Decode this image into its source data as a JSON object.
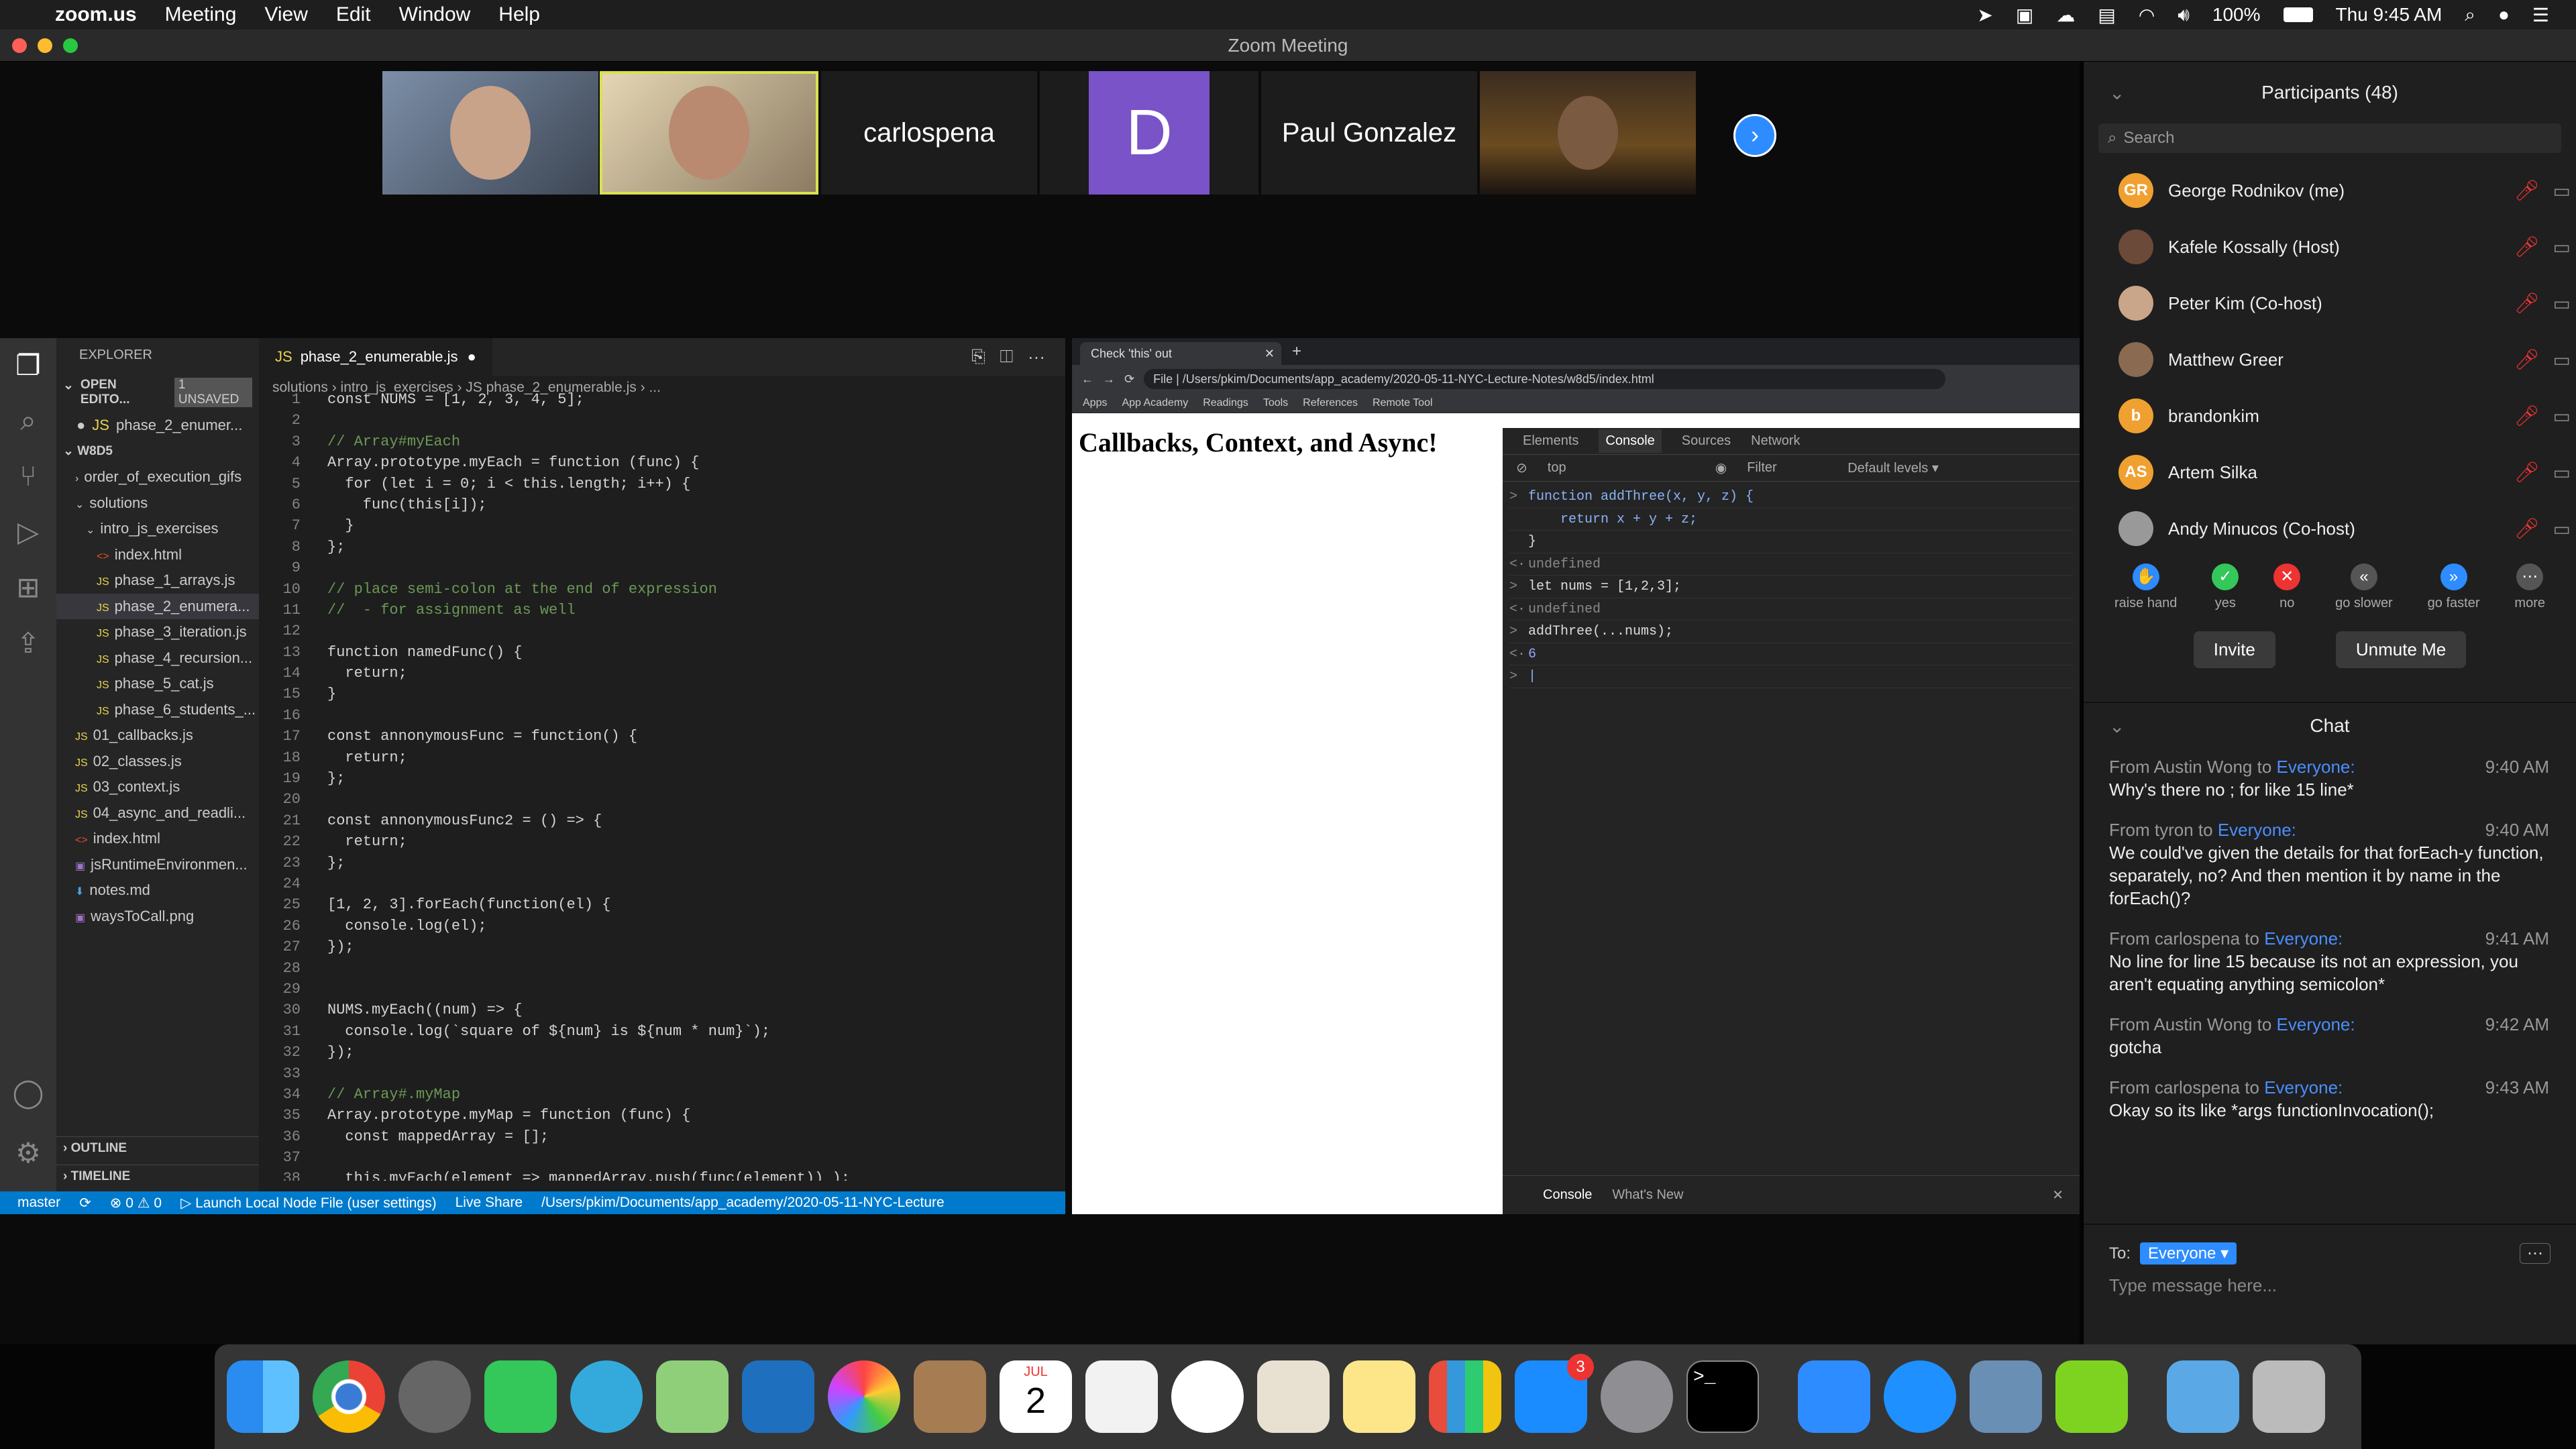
{
  "menubar": {
    "app": "zoom.us",
    "items": [
      "Meeting",
      "View",
      "Edit",
      "Window",
      "Help"
    ],
    "battery": "100%",
    "clock": "Thu 9:45 AM"
  },
  "window": {
    "title": "Zoom Meeting"
  },
  "gallery": {
    "names": [
      "carlospena",
      "D",
      "Paul Gonzalez"
    ]
  },
  "participants": {
    "title": "Participants (48)",
    "search_placeholder": "Search",
    "list": [
      {
        "initials": "GR",
        "name": "George Rodnikov (me)",
        "color": "#f0a030"
      },
      {
        "initials": "",
        "name": "Kafele Kossally (Host)",
        "color": "#6b4a3a"
      },
      {
        "initials": "",
        "name": "Peter Kim (Co-host)",
        "color": "#c9a58a"
      },
      {
        "initials": "",
        "name": "Matthew Greer",
        "color": "#8a6a50"
      },
      {
        "initials": "b",
        "name": "brandonkim",
        "color": "#f0a030"
      },
      {
        "initials": "AS",
        "name": "Artem Silka",
        "color": "#f0a030"
      },
      {
        "initials": "",
        "name": "Andy Minucos (Co-host)",
        "color": "#999"
      }
    ],
    "reactions": [
      "raise hand",
      "yes",
      "no",
      "go slower",
      "go faster",
      "more"
    ],
    "invite": "Invite",
    "unmute": "Unmute Me"
  },
  "chat": {
    "title": "Chat",
    "messages": [
      {
        "from": "From Austin Wong to",
        "to": "Everyone:",
        "time": "9:40 AM",
        "text": "Why's there no ; for like 15 line*"
      },
      {
        "from": "From tyron to",
        "to": "Everyone:",
        "time": "9:40 AM",
        "text": "We could've given the details for that forEach-y function, separately, no? And then mention it by name in the forEach()?"
      },
      {
        "from": "From carlospena to",
        "to": "Everyone:",
        "time": "9:41 AM",
        "text": "No line for line 15 because its not an expression, you aren't equating anything semicolon*"
      },
      {
        "from": "From Austin Wong to",
        "to": "Everyone:",
        "time": "9:42 AM",
        "text": "gotcha"
      },
      {
        "from": "From carlospena to",
        "to": "Everyone:",
        "time": "9:43 AM",
        "text": "Okay so its like *args functionInvocation();"
      }
    ],
    "to_label": "To:",
    "to_value": "Everyone",
    "placeholder": "Type message here..."
  },
  "vscode": {
    "explorer": "EXPLORER",
    "open_editors": "OPEN EDITO...",
    "unsaved": "1 UNSAVED",
    "open_file": "phase_2_enumer...",
    "folder": "W8D5",
    "tree": [
      {
        "name": "order_of_execution_gifs",
        "indent": 1,
        "type": "folder-c"
      },
      {
        "name": "solutions",
        "indent": 1,
        "type": "folder-o"
      },
      {
        "name": "intro_js_exercises",
        "indent": 2,
        "type": "folder-o"
      },
      {
        "name": "index.html",
        "indent": 3,
        "type": "html"
      },
      {
        "name": "phase_1_arrays.js",
        "indent": 3,
        "type": "js"
      },
      {
        "name": "phase_2_enumera...",
        "indent": 3,
        "type": "js",
        "active": true
      },
      {
        "name": "phase_3_iteration.js",
        "indent": 3,
        "type": "js"
      },
      {
        "name": "phase_4_recursion...",
        "indent": 3,
        "type": "js"
      },
      {
        "name": "phase_5_cat.js",
        "indent": 3,
        "type": "js"
      },
      {
        "name": "phase_6_students_...",
        "indent": 3,
        "type": "js"
      },
      {
        "name": "01_callbacks.js",
        "indent": 1,
        "type": "js"
      },
      {
        "name": "02_classes.js",
        "indent": 1,
        "type": "js"
      },
      {
        "name": "03_context.js",
        "indent": 1,
        "type": "js"
      },
      {
        "name": "04_async_and_readli...",
        "indent": 1,
        "type": "js"
      },
      {
        "name": "index.html",
        "indent": 1,
        "type": "html"
      },
      {
        "name": "jsRuntimeEnvironmen...",
        "indent": 1,
        "type": "img"
      },
      {
        "name": "notes.md",
        "indent": 1,
        "type": "md"
      },
      {
        "name": "waysToCall.png",
        "indent": 1,
        "type": "img"
      }
    ],
    "outline": "OUTLINE",
    "timeline": "TIMELINE",
    "tab": "phase_2_enumerable.js",
    "breadcrumb": "solutions › intro_js_exercises › JS phase_2_enumerable.js › ...",
    "code": [
      [
        "1",
        "const NUMS = [1, 2, 3, 4, 5];"
      ],
      [
        "2",
        ""
      ],
      [
        "3",
        "// Array#myEach"
      ],
      [
        "4",
        "Array.prototype.myEach = function (func) {"
      ],
      [
        "5",
        "  for (let i = 0; i < this.length; i++) {"
      ],
      [
        "6",
        "    func(this[i]);"
      ],
      [
        "7",
        "  }"
      ],
      [
        "8",
        "};"
      ],
      [
        "9",
        ""
      ],
      [
        "10",
        "// place semi-colon at the end of expression"
      ],
      [
        "11",
        "//  - for assignment as well"
      ],
      [
        "12",
        ""
      ],
      [
        "13",
        "function namedFunc() {"
      ],
      [
        "14",
        "  return;"
      ],
      [
        "15",
        "}"
      ],
      [
        "16",
        ""
      ],
      [
        "17",
        "const annonymousFunc = function() {"
      ],
      [
        "18",
        "  return;"
      ],
      [
        "19",
        "};"
      ],
      [
        "20",
        ""
      ],
      [
        "21",
        "const annonymousFunc2 = () => {"
      ],
      [
        "22",
        "  return;"
      ],
      [
        "23",
        "};"
      ],
      [
        "24",
        ""
      ],
      [
        "25",
        "[1, 2, 3].forEach(function(el) {"
      ],
      [
        "26",
        "  console.log(el);"
      ],
      [
        "27",
        "});"
      ],
      [
        "28",
        ""
      ],
      [
        "29",
        ""
      ],
      [
        "30",
        "NUMS.myEach((num) => {"
      ],
      [
        "31",
        "  console.log(`square of ${num} is ${num * num}`);"
      ],
      [
        "32",
        "});"
      ],
      [
        "33",
        ""
      ],
      [
        "34",
        "// Array#.myMap"
      ],
      [
        "35",
        "Array.prototype.myMap = function (func) {"
      ],
      [
        "36",
        "  const mappedArray = [];"
      ],
      [
        "37",
        ""
      ],
      [
        "38",
        "  this.myEach(element => mappedArray.push(func(element)) );"
      ]
    ],
    "status": {
      "branch": "master",
      "errors": "⊗ 0 ⚠ 0",
      "launch": "▷ Launch Local Node File (user settings)",
      "liveshare": "Live Share",
      "path": "/Users/pkim/Documents/app_academy/2020-05-11-NYC-Lecture"
    }
  },
  "browser": {
    "tab": "Check 'this' out",
    "url": "File  |  /Users/pkim/Documents/app_academy/2020-05-11-NYC-Lecture-Notes/w8d5/index.html",
    "bookmarks": [
      "Apps",
      "App Academy",
      "Readings",
      "Tools",
      "References",
      "Remote Tool"
    ],
    "heading": "Callbacks, Context, and Async!",
    "devtabs": [
      "Elements",
      "Console",
      "Sources",
      "Network"
    ],
    "context": "top",
    "filter": "Filter",
    "levels": "Default levels ▾",
    "console": [
      {
        "p": ">",
        "t": "function addThree(x, y, z) {",
        "c": "#8ab4f8"
      },
      {
        "p": "",
        "t": "    return x + y + z;",
        "c": "#8ab4f8"
      },
      {
        "p": "",
        "t": "}",
        "c": "#ddd"
      },
      {
        "p": "<·",
        "t": "undefined",
        "c": "#888"
      },
      {
        "p": ">",
        "t": "let nums = [1,2,3];",
        "c": "#ddd"
      },
      {
        "p": "<·",
        "t": "undefined",
        "c": "#888"
      },
      {
        "p": ">",
        "t": "addThree(...nums);",
        "c": "#ddd"
      },
      {
        "p": "<·",
        "t": "6",
        "c": "#9aa0ff"
      },
      {
        "p": ">",
        "t": "|",
        "c": "#8ab4f8"
      }
    ],
    "drawer": [
      "Console",
      "What's New"
    ]
  },
  "dock": {
    "calendar_month": "JUL",
    "calendar_day": "2",
    "badge": "3"
  }
}
